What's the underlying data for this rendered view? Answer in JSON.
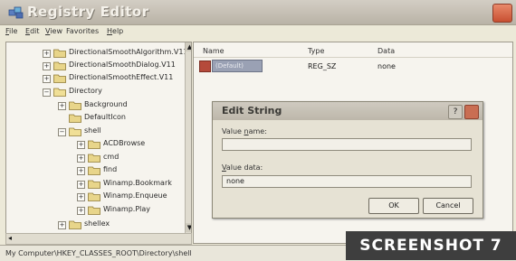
{
  "window": {
    "title": "Registry Editor"
  },
  "menu": {
    "items": [
      {
        "label": "File",
        "u": "F",
        "rest": "ile"
      },
      {
        "label": "Edit",
        "u": "E",
        "rest": "dit"
      },
      {
        "label": "View",
        "u": "V",
        "rest": "iew"
      },
      {
        "label": "Favorites",
        "u": "",
        "rest": "Favorites"
      },
      {
        "label": "Help",
        "u": "H",
        "rest": "elp"
      }
    ]
  },
  "tree": {
    "items": [
      {
        "label": "DirectionalSmoothAlgorithm.V11",
        "expander": "+"
      },
      {
        "label": "DirectionalSmoothDialog.V11",
        "expander": "+"
      },
      {
        "label": "DirectionalSmoothEffect.V11",
        "expander": "+"
      },
      {
        "label": "Directory",
        "expander": "−"
      },
      {
        "label": "Background",
        "expander": "+"
      },
      {
        "label": "DefaultIcon",
        "expander": ""
      },
      {
        "label": "shell",
        "expander": "−"
      },
      {
        "label": "ACDBrowse",
        "expander": "+"
      },
      {
        "label": "cmd",
        "expander": "+"
      },
      {
        "label": "find",
        "expander": "+"
      },
      {
        "label": "Winamp.Bookmark",
        "expander": "+"
      },
      {
        "label": "Winamp.Enqueue",
        "expander": "+"
      },
      {
        "label": "Winamp.Play",
        "expander": "+"
      },
      {
        "label": "shellex",
        "expander": "+"
      }
    ]
  },
  "list": {
    "columns": [
      "Name",
      "Type",
      "Data"
    ],
    "rows": [
      {
        "name": "(Default)",
        "type": "REG_SZ",
        "data": "none"
      }
    ]
  },
  "dialog": {
    "title": "Edit String",
    "value_name_label": "Value name:",
    "value_name_u": "n",
    "value_name_pre": "Value ",
    "value_name_post": "ame:",
    "value_name": "",
    "value_data_pre": "",
    "value_data_u": "V",
    "value_data_post": "alue data:",
    "value_data": "none",
    "ok_label": "OK",
    "cancel_label": "Cancel",
    "help_glyph": "?"
  },
  "status": {
    "path": "My Computer\\HKEY_CLASSES_ROOT\\Directory\\shell"
  },
  "badge": {
    "text": "SCREENSHOT 7"
  }
}
